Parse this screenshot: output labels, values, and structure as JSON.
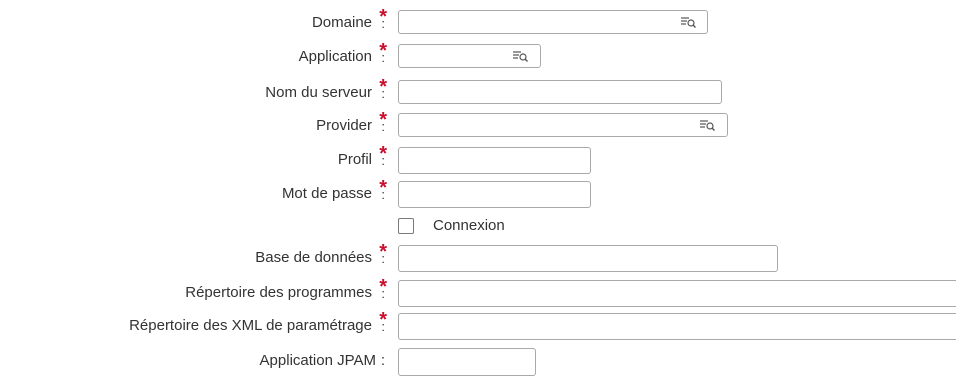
{
  "form": {
    "fields": {
      "domaine": {
        "label": "Domaine",
        "value": ""
      },
      "application": {
        "label": "Application",
        "value": ""
      },
      "nom_serveur": {
        "label": "Nom du serveur",
        "value": ""
      },
      "provider": {
        "label": "Provider",
        "value": ""
      },
      "profil": {
        "label": "Profil",
        "value": ""
      },
      "mot_de_passe": {
        "label": "Mot de passe",
        "value": ""
      },
      "base_donnees": {
        "label": "Base de données",
        "value": ""
      },
      "rep_programmes": {
        "label": "Répertoire des programmes",
        "value": ""
      },
      "rep_xml": {
        "label": "Répertoire des XML de paramétrage",
        "value": ""
      },
      "application_jpam": {
        "label": "Application JPAM",
        "value": ""
      }
    },
    "connexion": {
      "label": "Connexion",
      "checked": false
    },
    "required_marker": "*",
    "colon": ":",
    "lookup_icon": "lookup-list-icon"
  },
  "colors": {
    "required": "#c8102e",
    "border": "#a9a9a9"
  }
}
